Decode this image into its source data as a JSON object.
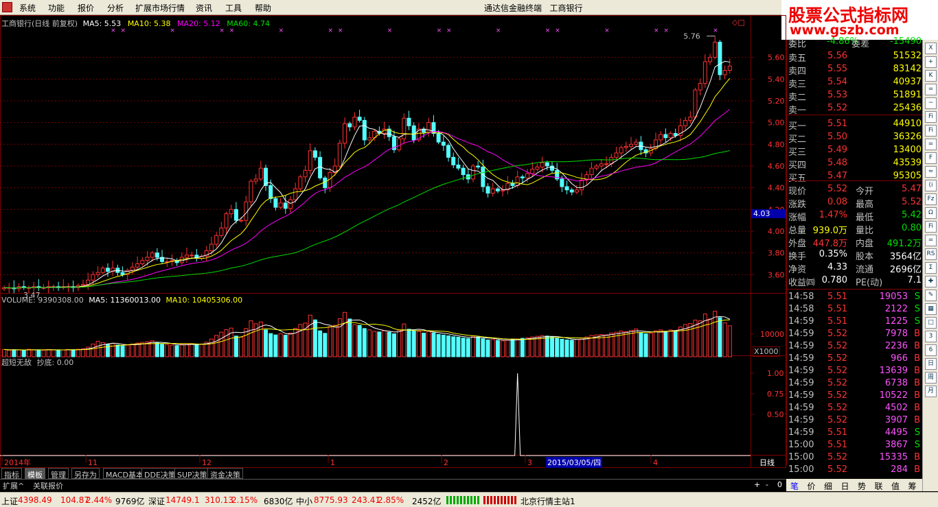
{
  "menu": {
    "items": [
      "系统",
      "功能",
      "报价",
      "分析",
      "扩展市场行情",
      "资讯",
      "工具",
      "帮助"
    ],
    "title": "通达信金融终端",
    "stock": "工商银行"
  },
  "logo": {
    "cn": "股票公式指标网",
    "url": "www.gszb.com"
  },
  "price_header": {
    "name": "工商银行(日线 前复权)",
    "ma5": "MA5: 5.53",
    "ma10": "MA10: 5.38",
    "ma20": "MA20: 5.12",
    "ma60": "MA60: 4.74"
  },
  "vol_header": {
    "vol": "VOLUME: 9390308.00",
    "ma5": "MA5: 11360013.00",
    "ma10": "MA10: 10405306.00"
  },
  "ind_header": {
    "name": "超短无敌",
    "val": "抄底: 0.00"
  },
  "annot": {
    "high": "5.76",
    "low": "3.47",
    "cursor": "4.03",
    "vol_unit": "X1000",
    "vol_tick": "10000",
    "date_cursor": "2015/03/05/四",
    "period": "日线",
    "zoom_plus": "+",
    "zoom_minus": "-",
    "zoom_zero": "0",
    "top_icons": "◇□"
  },
  "x_labels": [
    {
      "t": "2014年",
      "x": 6
    },
    {
      "t": "11",
      "x": 128
    },
    {
      "t": "12",
      "x": 294
    },
    {
      "t": "1",
      "x": 481
    },
    {
      "t": "2",
      "x": 646
    },
    {
      "t": "3",
      "x": 768
    },
    {
      "t": "4",
      "x": 951
    }
  ],
  "colors": {
    "up": "#ff3232",
    "down": "#54ffff",
    "ma5": "#ffffff",
    "ma10": "#ffff00",
    "ma20": "#ff00ff",
    "ma60": "#00e000",
    "grid": "#800000"
  },
  "chart_data": [
    {
      "type": "candlestick",
      "title": "工商银行(日线 前复权)",
      "ylim": [
        3.4,
        5.85
      ],
      "yticks": [
        "5.60",
        "5.40",
        "5.20",
        "5.00",
        "4.80",
        "4.60",
        "4.40",
        "4.20",
        "4.00",
        "3.80",
        "3.60"
      ],
      "close": [
        3.48,
        3.48,
        3.47,
        3.49,
        3.48,
        3.48,
        3.49,
        3.48,
        3.48,
        3.49,
        3.49,
        3.48,
        3.49,
        3.49,
        3.48,
        3.5,
        3.51,
        3.55,
        3.6,
        3.62,
        3.66,
        3.63,
        3.66,
        3.62,
        3.6,
        3.64,
        3.67,
        3.7,
        3.73,
        3.76,
        3.8,
        3.76,
        3.72,
        3.72,
        3.73,
        3.71,
        3.76,
        3.78,
        3.78,
        3.75,
        3.77,
        3.82,
        3.88,
        3.96,
        4.03,
        4.16,
        4.2,
        4.1,
        4.1,
        4.27,
        4.46,
        4.48,
        4.58,
        4.42,
        4.3,
        4.22,
        4.26,
        4.21,
        4.29,
        4.39,
        4.5,
        4.56,
        4.74,
        4.68,
        4.49,
        4.4,
        4.54,
        4.6,
        4.81,
        4.99,
        4.96,
        5.05,
        5.02,
        4.84,
        4.86,
        4.92,
        4.9,
        4.94,
        4.87,
        4.75,
        4.85,
        5.04,
        4.97,
        4.84,
        4.94,
        4.91,
        5,
        4.9,
        4.82,
        4.79,
        4.68,
        4.61,
        4.58,
        4.52,
        4.48,
        4.6,
        4.59,
        4.41,
        4.35,
        4.39,
        4.37,
        4.38,
        4.44,
        4.42,
        4.5,
        4.49,
        4.53,
        4.57,
        4.59,
        4.63,
        4.6,
        4.56,
        4.48,
        4.41,
        4.38,
        4.36,
        4.38,
        4.47,
        4.52,
        4.58,
        4.6,
        4.62,
        4.62,
        4.68,
        4.72,
        4.77,
        4.78,
        4.8,
        4.82,
        4.75,
        4.72,
        4.76,
        4.84,
        4.89,
        4.86,
        4.9,
        4.88,
        4.97,
        5.02,
        5.05,
        5.3,
        5.36,
        5.56,
        5.6,
        5.74,
        5.44,
        5.48,
        5.52
      ],
      "open": [
        3.47,
        3.48,
        3.48,
        3.47,
        3.49,
        3.48,
        3.48,
        3.49,
        3.48,
        3.48,
        3.49,
        3.49,
        3.48,
        3.49,
        3.49,
        3.48,
        3.5,
        3.51,
        3.55,
        3.6,
        3.62,
        3.66,
        3.63,
        3.66,
        3.62,
        3.6,
        3.64,
        3.67,
        3.7,
        3.73,
        3.76,
        3.8,
        3.76,
        3.72,
        3.72,
        3.73,
        3.71,
        3.76,
        3.78,
        3.78,
        3.75,
        3.77,
        3.82,
        3.88,
        3.96,
        4.03,
        4.16,
        4.2,
        4.1,
        4.1,
        4.27,
        4.46,
        4.48,
        4.58,
        4.42,
        4.3,
        4.22,
        4.26,
        4.21,
        4.29,
        4.39,
        4.5,
        4.56,
        4.74,
        4.68,
        4.49,
        4.4,
        4.54,
        4.6,
        4.81,
        4.99,
        4.96,
        5.05,
        5.02,
        4.84,
        4.86,
        4.92,
        4.9,
        4.94,
        4.87,
        4.75,
        4.85,
        5.04,
        4.97,
        4.84,
        4.94,
        4.91,
        5,
        4.9,
        4.82,
        4.79,
        4.68,
        4.61,
        4.58,
        4.52,
        4.48,
        4.6,
        4.59,
        4.41,
        4.35,
        4.39,
        4.37,
        4.38,
        4.44,
        4.42,
        4.5,
        4.49,
        4.53,
        4.57,
        4.59,
        4.63,
        4.6,
        4.56,
        4.48,
        4.41,
        4.38,
        4.36,
        4.38,
        4.47,
        4.52,
        4.58,
        4.6,
        4.62,
        4.62,
        4.68,
        4.72,
        4.77,
        4.78,
        4.8,
        4.82,
        4.75,
        4.72,
        4.76,
        4.84,
        4.89,
        4.86,
        4.9,
        4.88,
        4.97,
        5.02,
        5.05,
        5.3,
        5.36,
        5.56,
        5.6,
        5.74,
        5.44,
        5.48
      ],
      "volume": [
        3200,
        2900,
        3100,
        3000,
        2800,
        3300,
        3100,
        3000,
        2900,
        3200,
        3100,
        2900,
        3000,
        3200,
        3100,
        3300,
        3500,
        4200,
        5600,
        6800,
        6200,
        5400,
        5800,
        5200,
        4800,
        5100,
        5600,
        6000,
        6300,
        6600,
        7000,
        6100,
        5500,
        5300,
        5100,
        4900,
        5400,
        5700,
        5800,
        5200,
        5600,
        6400,
        7800,
        9400,
        10800,
        11900,
        12600,
        9100,
        8600,
        12400,
        15800,
        14500,
        15300,
        11800,
        10200,
        9600,
        10100,
        9500,
        10400,
        12500,
        14200,
        14800,
        18300,
        16200,
        11400,
        10300,
        13200,
        13800,
        16700,
        19500,
        16600,
        14100,
        13800,
        12400,
        11800,
        11200,
        10900,
        11400,
        10800,
        10100,
        11600,
        14400,
        12100,
        11300,
        11100,
        10400,
        11200,
        10500,
        9800,
        9500,
        9200,
        8800,
        8600,
        8200,
        8000,
        9000,
        8700,
        7900,
        7400,
        7600,
        7200,
        7000,
        7400,
        7600,
        7800,
        8100,
        8300,
        8700,
        9000,
        9300,
        9100,
        8700,
        8100,
        7700,
        7400,
        7300,
        7600,
        8200,
        8700,
        9400,
        9600,
        9800,
        9600,
        10400,
        10800,
        11300,
        11000,
        11600,
        12200,
        10600,
        10100,
        10400,
        11400,
        11800,
        11200,
        11800,
        11500,
        13100,
        14200,
        14600,
        16100,
        15800,
        18800,
        16600,
        20000,
        17200,
        14900,
        13600
      ],
      "buy_marks": [
        56,
        58,
        67,
        76,
        81,
        93,
        117,
        144,
        151,
        165,
        166,
        172,
        177,
        185,
        198,
        235,
        240,
        249
      ],
      "marks_x": []
    },
    {
      "type": "bar",
      "title": "VOLUME",
      "ytick": "10000",
      "unit": "X1000"
    },
    {
      "type": "line",
      "title": "超短无敌",
      "yticks": [
        "1.00",
        "0.75",
        "0.50"
      ],
      "spike_index": 104,
      "spike_value": 1.0
    }
  ],
  "tabs": [
    "指标",
    "模板",
    "管理",
    "另存为",
    "MACD基本",
    "DDE决策",
    "SUP决策",
    "资金决策"
  ],
  "subbar": [
    "扩展^",
    "关联报价"
  ],
  "quote": {
    "top": [
      {
        "k": "委比",
        "v": "-4.86%",
        "k2": "委差",
        "v2": "-15490"
      }
    ],
    "sell": [
      {
        "k": "卖五",
        "p": "5.56",
        "v": "51532"
      },
      {
        "k": "卖四",
        "p": "5.55",
        "v": "83142"
      },
      {
        "k": "卖三",
        "p": "5.54",
        "v": "40937"
      },
      {
        "k": "卖二",
        "p": "5.53",
        "v": "51891"
      },
      {
        "k": "卖一",
        "p": "5.52",
        "v": "25436"
      }
    ],
    "buy": [
      {
        "k": "买一",
        "p": "5.51",
        "v": "44910"
      },
      {
        "k": "买二",
        "p": "5.50",
        "v": "36326"
      },
      {
        "k": "买三",
        "p": "5.49",
        "v": "13400"
      },
      {
        "k": "买四",
        "p": "5.48",
        "v": "43539"
      },
      {
        "k": "买五",
        "p": "5.47",
        "v": "95305"
      }
    ],
    "stats": [
      {
        "k1": "现价",
        "v1": "5.52",
        "c1": "#ff3232",
        "k2": "今开",
        "v2": "5.47",
        "c2": "#ff3232"
      },
      {
        "k1": "涨跌",
        "v1": "0.08",
        "c1": "#ff3232",
        "k2": "最高",
        "v2": "5.52",
        "c2": "#ff3232"
      },
      {
        "k1": "涨幅",
        "v1": "1.47%",
        "c1": "#ff3232",
        "k2": "最低",
        "v2": "5.42",
        "c2": "#00e000"
      },
      {
        "k1": "总量",
        "v1": "939.0万",
        "c1": "#ffff00",
        "k2": "量比",
        "v2": "0.80",
        "c2": "#00e000"
      },
      {
        "k1": "外盘",
        "v1": "447.8万",
        "c1": "#ff3232",
        "k2": "内盘",
        "v2": "491.2万",
        "c2": "#00e000"
      },
      {
        "k1": "换手",
        "v1": "0.35%",
        "c1": "#ffffff",
        "k2": "股本",
        "v2": "3564亿",
        "c2": "#ffffff"
      },
      {
        "k1": "净资",
        "v1": "4.33",
        "c1": "#ffffff",
        "k2": "流通",
        "v2": "2696亿",
        "c2": "#ffffff"
      },
      {
        "k1": "收益㈣",
        "v1": "0.780",
        "c1": "#ffffff",
        "k2": "PE(动)",
        "v2": "7.1",
        "c2": "#ffffff"
      }
    ],
    "ticks": [
      {
        "t": "14:58",
        "p": "5.51",
        "v": "19053",
        "bs": "S"
      },
      {
        "t": "14:58",
        "p": "5.51",
        "v": "2122",
        "bs": "S"
      },
      {
        "t": "14:59",
        "p": "5.51",
        "v": "1225",
        "bs": "S"
      },
      {
        "t": "14:59",
        "p": "5.52",
        "v": "7978",
        "bs": "B"
      },
      {
        "t": "14:59",
        "p": "5.52",
        "v": "2236",
        "bs": "B"
      },
      {
        "t": "14:59",
        "p": "5.52",
        "v": "966",
        "bs": "B"
      },
      {
        "t": "14:59",
        "p": "5.52",
        "v": "13639",
        "bs": "B"
      },
      {
        "t": "14:59",
        "p": "5.52",
        "v": "6738",
        "bs": "B"
      },
      {
        "t": "14:59",
        "p": "5.52",
        "v": "10522",
        "bs": "B"
      },
      {
        "t": "14:59",
        "p": "5.52",
        "v": "4502",
        "bs": "B"
      },
      {
        "t": "14:59",
        "p": "5.52",
        "v": "3907",
        "bs": "B"
      },
      {
        "t": "14:59",
        "p": "5.51",
        "v": "4495",
        "bs": "S"
      },
      {
        "t": "15:00",
        "p": "5.51",
        "v": "3867",
        "bs": "S"
      },
      {
        "t": "15:00",
        "p": "5.52",
        "v": "15335",
        "bs": "B"
      },
      {
        "t": "15:00",
        "p": "5.52",
        "v": "284",
        "bs": "B"
      }
    ]
  },
  "panel_tabs": [
    "笔",
    "价",
    "细",
    "日",
    "势",
    "联",
    "值",
    "筹"
  ],
  "right_icons": [
    "X",
    "+",
    "K",
    "=",
    "~",
    "Fi",
    "Fi",
    "=",
    "F",
    "≈",
    "(i",
    "Fz",
    "Ω",
    "Fi",
    "=",
    "RS",
    "Σ",
    "✚",
    "✎",
    "▦",
    "□",
    "3",
    "6",
    "日",
    "周",
    "月"
  ],
  "status": {
    "sh_lbl": "上证",
    "sh_val": "4398.49",
    "sh_chg": "104.87",
    "sh_pct": "2.44%",
    "sh_amt": "9769亿",
    "sz_lbl": "深证",
    "sz_val": "14749.1",
    "sz_chg": "310.13",
    "sz_pct": "2.15%",
    "sz_amt": "6830亿",
    "zx_lbl": "中小",
    "zx_val": "8775.93",
    "zx_chg": "243.41",
    "zx_pct": "2.85%",
    "zx_amt": "2452亿",
    "server": "北京行情主站1"
  }
}
